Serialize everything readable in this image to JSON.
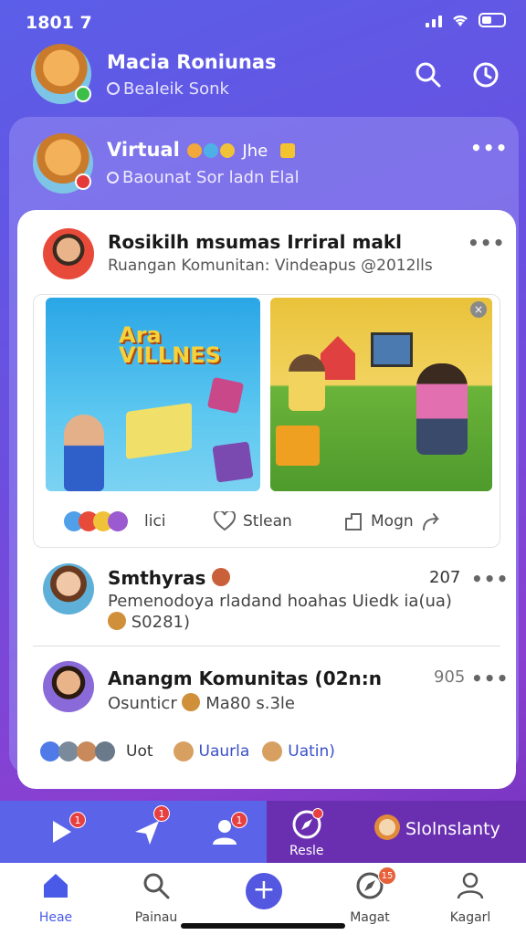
{
  "status": {
    "time": "1801 7"
  },
  "header": {
    "name": "Macia Roniunas",
    "subtitle": "Bealeik Sonk"
  },
  "featured": {
    "name": "Virtual",
    "emoji_text": "Jhe",
    "subtitle": "Baounat Sor ladn Elal"
  },
  "post": {
    "title": "Rosikilh msumas Irriral makl",
    "subtitle": "Ruangan Komunitan: Vindeapus @2012lls",
    "image_caption": "Ara VILLNES",
    "reactions": {
      "like_text": "lici",
      "love_label": "Stlean",
      "share_label": "Mogn"
    }
  },
  "comments": [
    {
      "name": "Smthyras",
      "count": "207",
      "text": "Pemenodoya rladand hoahas Uiedk ia(ua)",
      "meta": "S0281)"
    },
    {
      "name": "Anangm Komunitas (02n:n",
      "count": "905",
      "meta": "Osunticr",
      "meta2": "Ma80 s.3le"
    }
  ],
  "reaction_row": {
    "label1": "Uot",
    "label2": "Uaurla",
    "label3": "Uatin)"
  },
  "toolbar": {
    "notif1": "1",
    "notif2": "1",
    "notif3": "1",
    "active_label": "Resle",
    "right_label": "Slolnslanty"
  },
  "tabs": [
    {
      "label": "Heae",
      "icon": "home-icon"
    },
    {
      "label": "Painau",
      "icon": "search-icon"
    },
    {
      "label": "",
      "icon": "plus-icon"
    },
    {
      "label": "Magat",
      "icon": "compass-icon",
      "badge": "15"
    },
    {
      "label": "Kagarl",
      "icon": "profile-icon"
    }
  ],
  "colors": {
    "accent": "#5457e0",
    "header_bg": "#5b5ee8",
    "toolbar_right": "#6a2fb0"
  }
}
